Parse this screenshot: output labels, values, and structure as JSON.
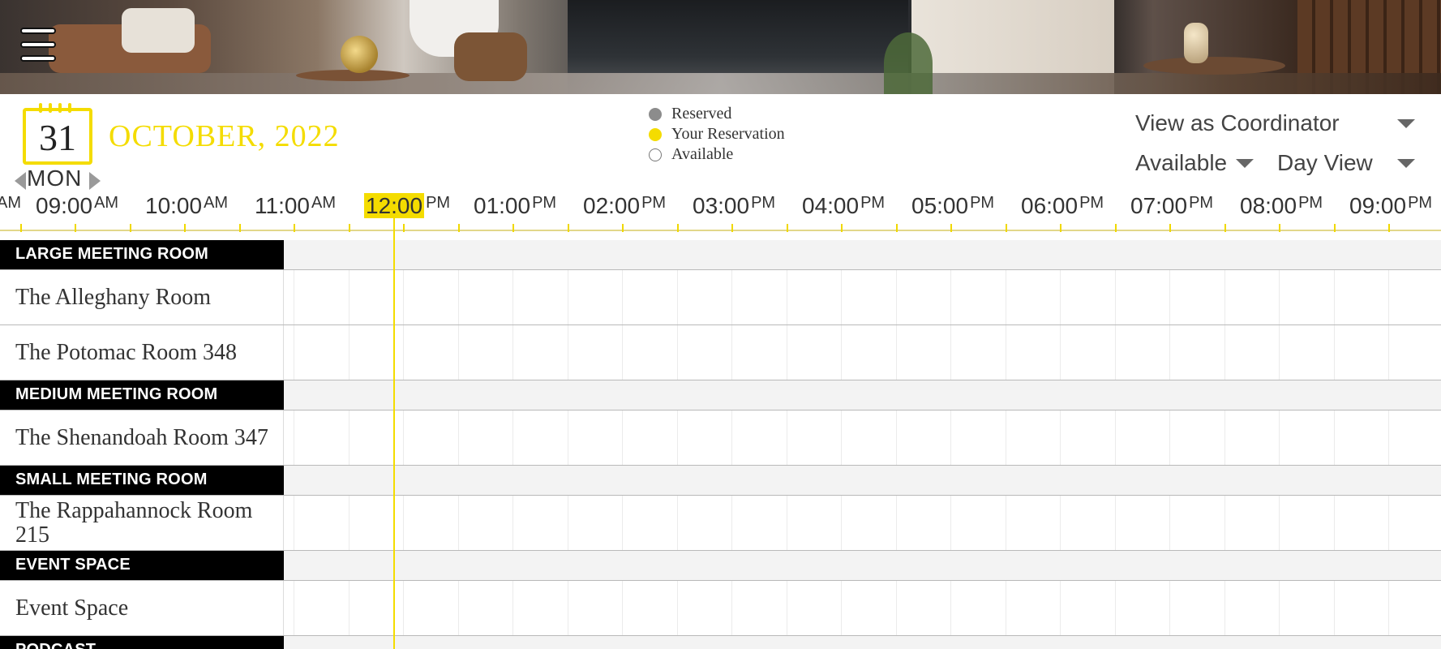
{
  "header": {
    "day_number": "31",
    "weekday": "MON",
    "month_title": "OCTOBER, 2022"
  },
  "legend": [
    {
      "label": "Reserved",
      "color": "#8c8c8c",
      "filled": true
    },
    {
      "label": "Your Reservation",
      "color": "#f4dc00",
      "filled": true
    },
    {
      "label": "Available",
      "color": "#ffffff",
      "filled": false
    }
  ],
  "controls": {
    "role_select": "View as Coordinator",
    "filter_select": "Available",
    "view_select": "Day View"
  },
  "timeline": {
    "ticks": [
      {
        "hour": "",
        "ampm": "AM"
      },
      {
        "hour": "09:00",
        "ampm": "AM"
      },
      {
        "hour": "10:00",
        "ampm": "AM"
      },
      {
        "hour": "11:00",
        "ampm": "AM"
      },
      {
        "hour": "12:00",
        "ampm": "PM"
      },
      {
        "hour": "01:00",
        "ampm": "PM"
      },
      {
        "hour": "02:00",
        "ampm": "PM"
      },
      {
        "hour": "03:00",
        "ampm": "PM"
      },
      {
        "hour": "04:00",
        "ampm": "PM"
      },
      {
        "hour": "05:00",
        "ampm": "PM"
      },
      {
        "hour": "06:00",
        "ampm": "PM"
      },
      {
        "hour": "07:00",
        "ampm": "PM"
      },
      {
        "hour": "08:00",
        "ampm": "PM"
      },
      {
        "hour": "09:00",
        "ampm": "PM"
      }
    ],
    "current_hour": "12:00"
  },
  "rows": [
    {
      "kind": "group",
      "label": "LARGE MEETING ROOM"
    },
    {
      "kind": "room",
      "label": "The Alleghany Room"
    },
    {
      "kind": "room",
      "label": "The Potomac Room 348"
    },
    {
      "kind": "group",
      "label": "MEDIUM MEETING ROOM"
    },
    {
      "kind": "room",
      "label": "The Shenandoah Room 347"
    },
    {
      "kind": "group",
      "label": "SMALL MEETING ROOM"
    },
    {
      "kind": "room",
      "label": "The Rappahannock Room 215"
    },
    {
      "kind": "group",
      "label": "EVENT SPACE"
    },
    {
      "kind": "room",
      "label": "Event Space"
    },
    {
      "kind": "group",
      "label": "PODCAST"
    }
  ]
}
